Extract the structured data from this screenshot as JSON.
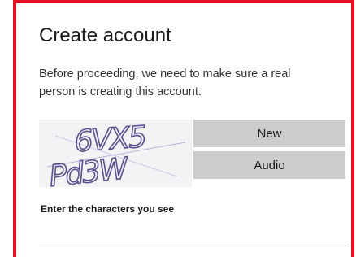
{
  "dialog": {
    "title": "Create account",
    "description": "Before proceeding, we need to make sure a real person is creating this account."
  },
  "captcha": {
    "line1": "6VX5",
    "line2": "Pd3W"
  },
  "buttons": {
    "new_label": "New",
    "audio_label": "Audio"
  },
  "input": {
    "label": "Enter the characters you see",
    "value": "",
    "placeholder": ""
  },
  "colors": {
    "highlight_border": "#e81123",
    "button_bg": "#cccccc",
    "captcha_ink": "#5a4f8f"
  }
}
